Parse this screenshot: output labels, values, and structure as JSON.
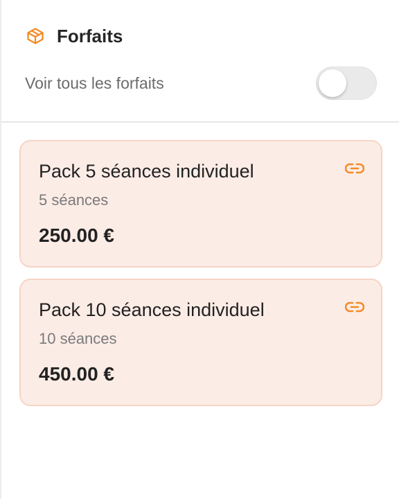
{
  "panel": {
    "title": "Forfaits",
    "title_icon": "package-icon",
    "accent_color": "#f28c28"
  },
  "toggle": {
    "label": "Voir tous les forfaits",
    "checked": false
  },
  "packages": [
    {
      "name": "Pack 5 séances individuel",
      "sessions": "5 séances",
      "price": "250.00 €",
      "icon": "link-icon"
    },
    {
      "name": "Pack 10 séances individuel",
      "sessions": "10 séances",
      "price": "450.00 €",
      "icon": "link-icon"
    }
  ]
}
